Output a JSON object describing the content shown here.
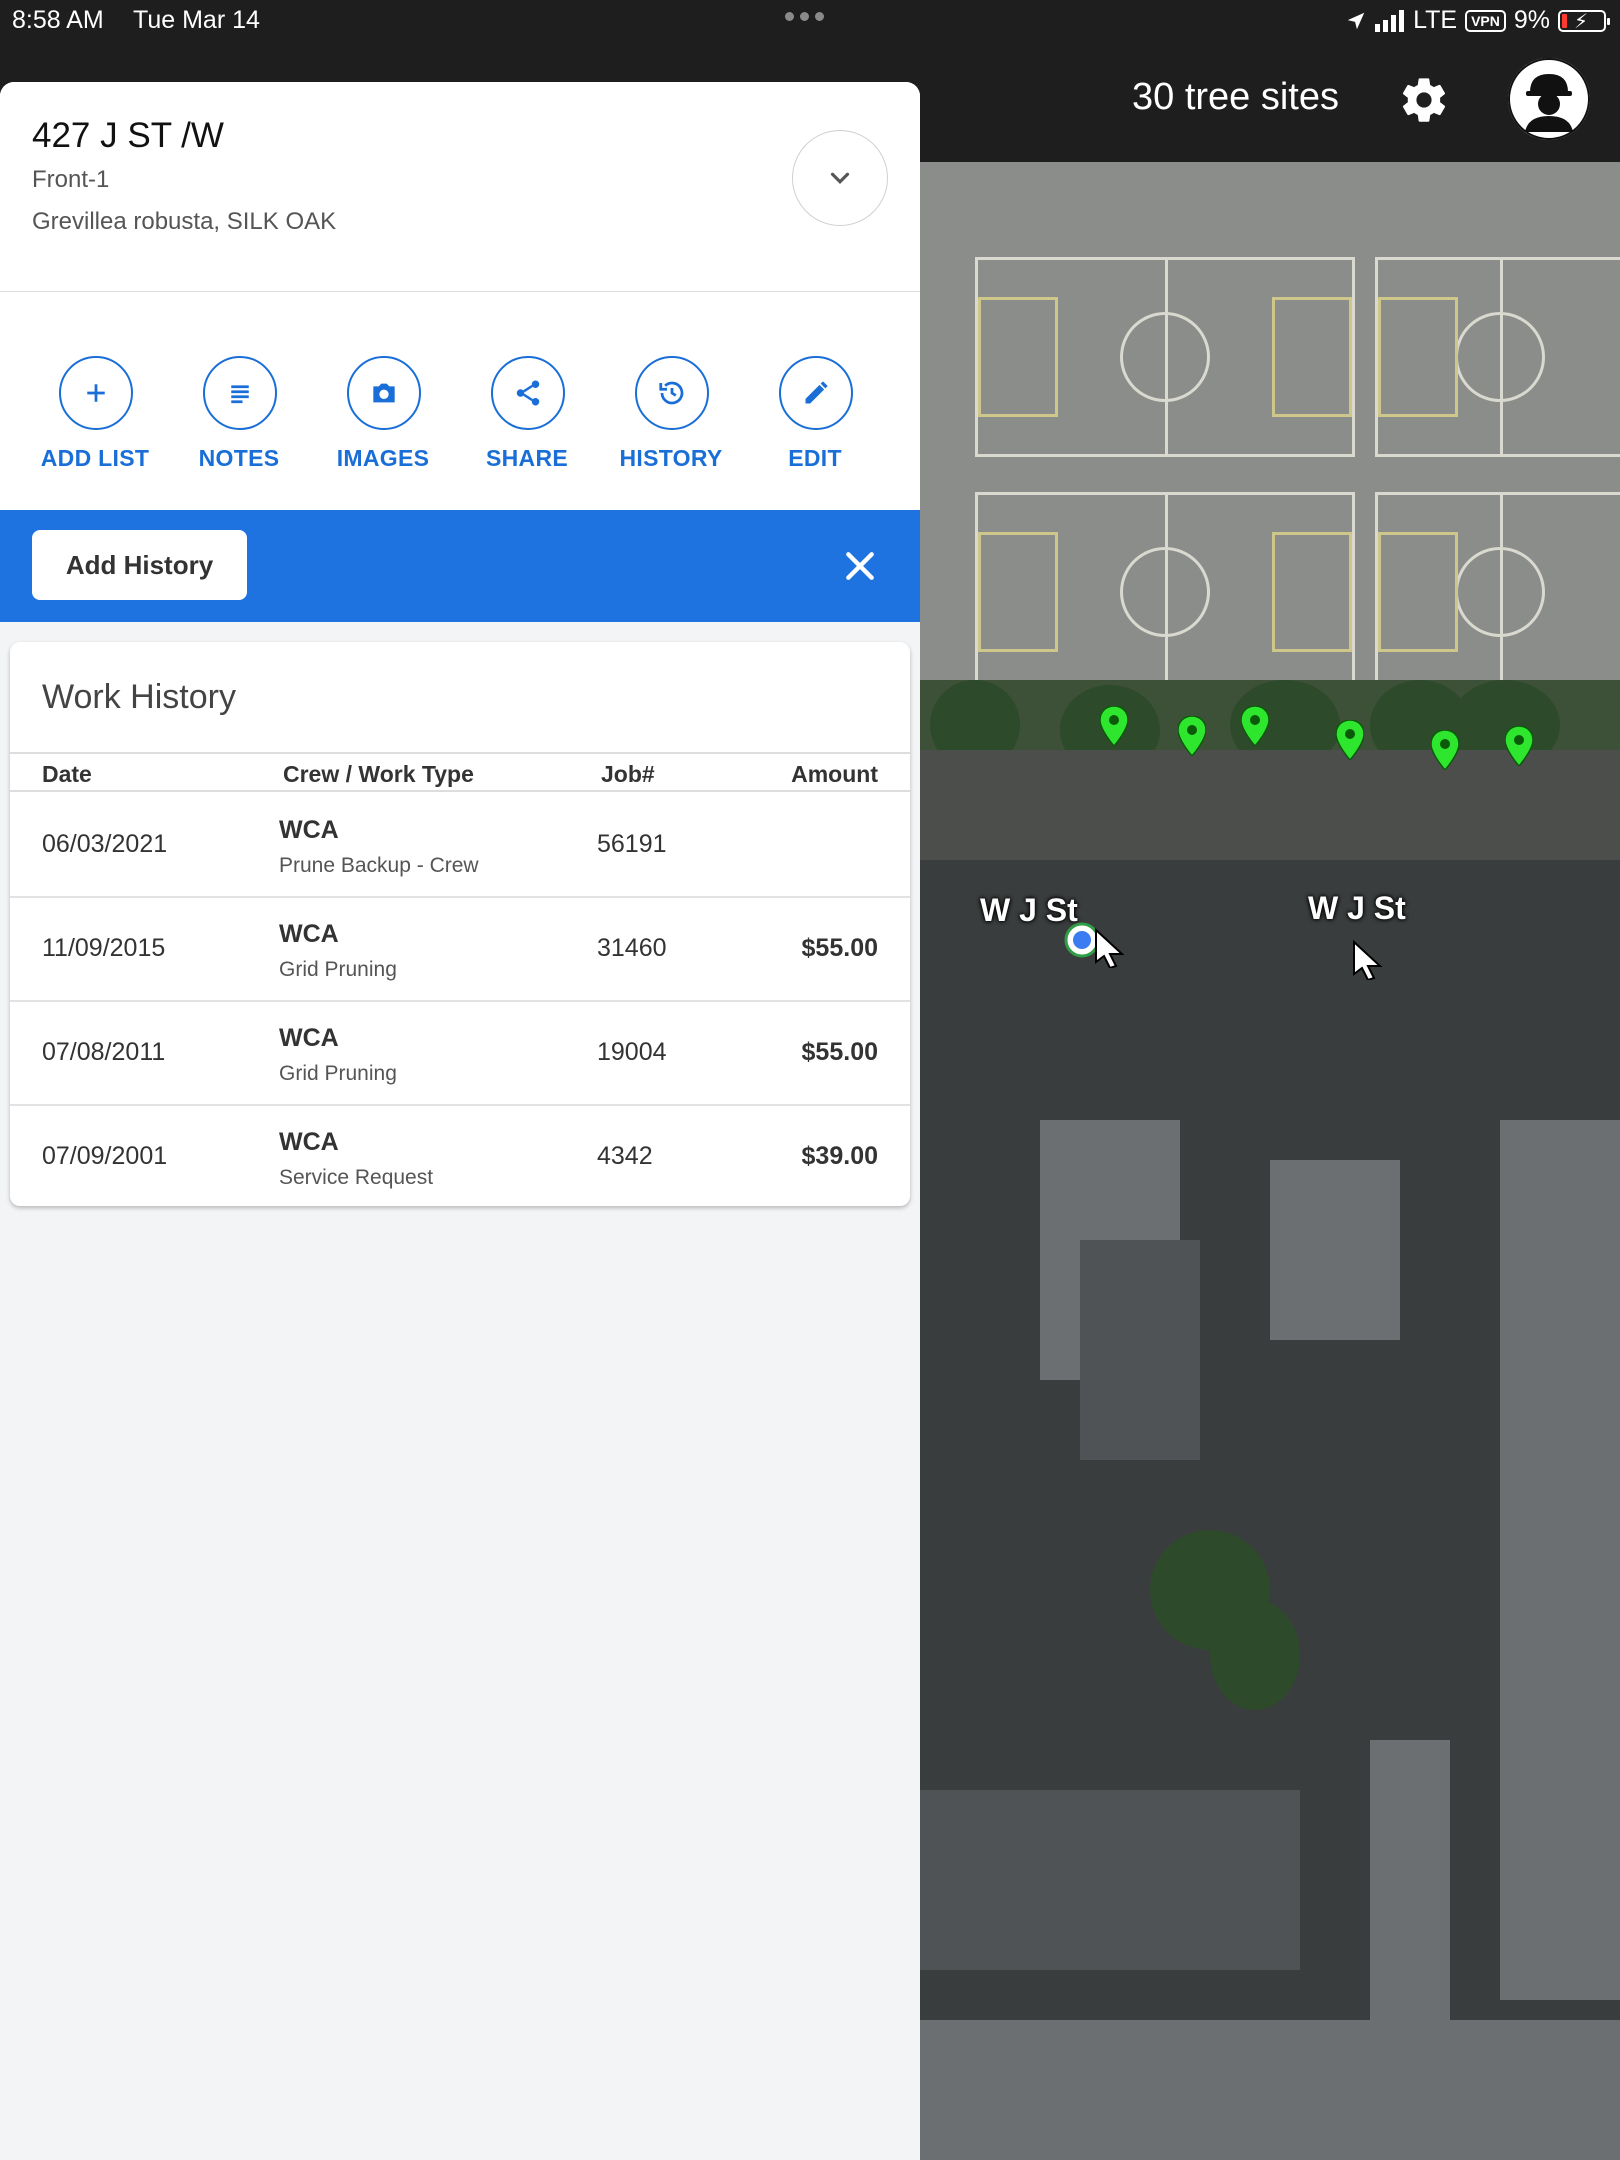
{
  "status_bar": {
    "time": "8:58 AM",
    "date": "Tue Mar 14",
    "network": "LTE",
    "vpn": "VPN",
    "battery": "9%"
  },
  "top_bar": {
    "sites_count_label": "30 tree sites",
    "settings_icon": "gear-icon",
    "avatar_icon": "hardhat-user-icon"
  },
  "map": {
    "street_labels": [
      "W J St",
      "W J St"
    ],
    "marker_color": "#2ee62e"
  },
  "site": {
    "address": "427 J ST /W",
    "location": "Front-1",
    "species": "Grevillea robusta, SILK OAK"
  },
  "actions": [
    {
      "label": "ADD LIST",
      "icon": "plus-icon"
    },
    {
      "label": "NOTES",
      "icon": "notes-icon"
    },
    {
      "label": "IMAGES",
      "icon": "camera-icon"
    },
    {
      "label": "SHARE",
      "icon": "share-icon"
    },
    {
      "label": "HISTORY",
      "icon": "history-icon"
    },
    {
      "label": "EDIT",
      "icon": "pencil-icon"
    }
  ],
  "history_bar": {
    "add_label": "Add History",
    "accent": "#1f73e0"
  },
  "work_history": {
    "title": "Work History",
    "columns": [
      "Date",
      "Crew / Work Type",
      "Job#",
      "Amount"
    ],
    "rows": [
      {
        "date": "06/03/2021",
        "crew": "WCA",
        "work_type": "Prune Backup - Crew",
        "job": "56191",
        "amount": ""
      },
      {
        "date": "11/09/2015",
        "crew": "WCA",
        "work_type": "Grid Pruning",
        "job": "31460",
        "amount": "$55.00"
      },
      {
        "date": "07/08/2011",
        "crew": "WCA",
        "work_type": "Grid Pruning",
        "job": "19004",
        "amount": "$55.00"
      },
      {
        "date": "07/09/2001",
        "crew": "WCA",
        "work_type": "Service Request",
        "job": "4342",
        "amount": "$39.00"
      }
    ]
  }
}
